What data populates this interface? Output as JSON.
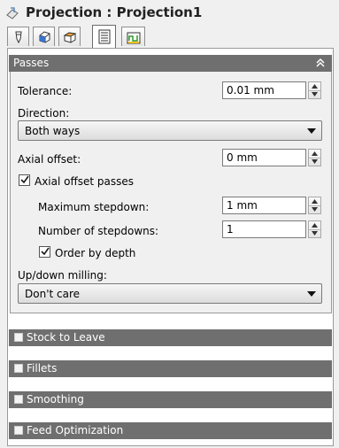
{
  "window": {
    "title": "Projection : Projection1",
    "title_icon": "projection-icon"
  },
  "tabs": [
    {
      "icon": "tool-icon"
    },
    {
      "icon": "geometry-icon"
    },
    {
      "icon": "heights-icon"
    },
    {
      "icon": "passes-icon",
      "active": true
    },
    {
      "icon": "linking-icon"
    }
  ],
  "passes": {
    "header": "Passes",
    "tolerance_label": "Tolerance:",
    "tolerance_value": "0.01 mm",
    "direction_label": "Direction:",
    "direction_value": "Both ways",
    "axial_offset_label": "Axial offset:",
    "axial_offset_value": "0 mm",
    "axial_offset_passes_label": "Axial offset passes",
    "axial_offset_passes_checked": true,
    "max_stepdown_label": "Maximum stepdown:",
    "max_stepdown_value": "1 mm",
    "num_stepdowns_label": "Number of stepdowns:",
    "num_stepdowns_value": "1",
    "order_by_depth_label": "Order by depth",
    "order_by_depth_checked": true,
    "updown_label": "Up/down milling:",
    "updown_value": "Don't care"
  },
  "sections": [
    {
      "label": "Stock to Leave",
      "checked": false
    },
    {
      "label": "Fillets",
      "checked": false
    },
    {
      "label": "Smoothing",
      "checked": false
    },
    {
      "label": "Feed Optimization",
      "checked": false
    }
  ],
  "colors": {
    "section_header": "#6f6f6f",
    "panel_bg": "#f0f0f0"
  }
}
